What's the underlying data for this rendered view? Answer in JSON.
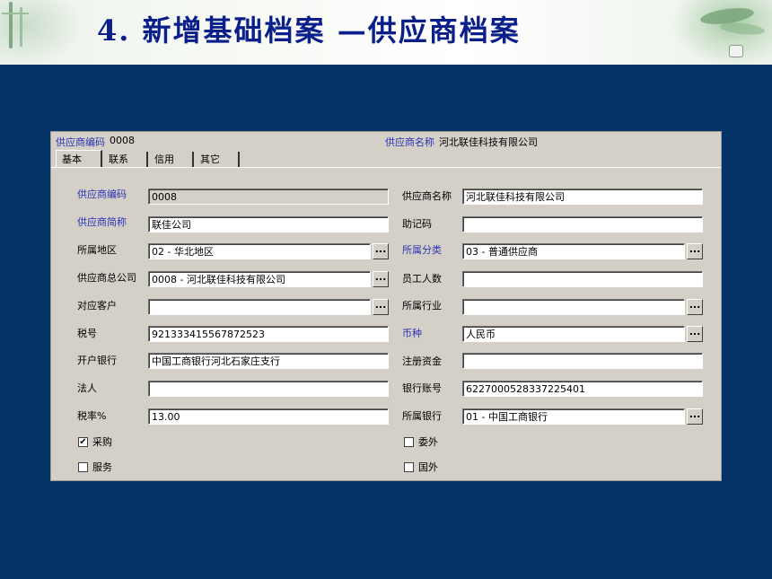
{
  "slide": {
    "title": "4. 新增基础档案 —供应商档案"
  },
  "header": {
    "code_label": "供应商编码",
    "code_value": "0008",
    "name_label": "供应商名称",
    "name_value": "河北联佳科技有限公司"
  },
  "tabs": [
    "基本",
    "联系",
    "信用",
    "其它"
  ],
  "active_tab": "基本",
  "form": {
    "supplier_code": {
      "label": "供应商编码",
      "value": "0008"
    },
    "supplier_name": {
      "label": "供应商名称",
      "value": "河北联佳科技有限公司"
    },
    "short_name": {
      "label": "供应商简称",
      "value": "联佳公司"
    },
    "mnemonic": {
      "label": "助记码",
      "value": ""
    },
    "region": {
      "label": "所属地区",
      "value": "02 - 华北地区"
    },
    "category": {
      "label": "所属分类",
      "value": "03 - 普通供应商"
    },
    "parent_company": {
      "label": "供应商总公司",
      "value": "0008 - 河北联佳科技有限公司"
    },
    "employees": {
      "label": "员工人数",
      "value": ""
    },
    "customer": {
      "label": "对应客户",
      "value": ""
    },
    "industry": {
      "label": "所属行业",
      "value": ""
    },
    "tax_id": {
      "label": "税号",
      "value": "921333415567872523"
    },
    "currency": {
      "label": "币种",
      "value": "人民币"
    },
    "bank": {
      "label": "开户银行",
      "value": "中国工商银行河北石家庄支行"
    },
    "capital": {
      "label": "注册资金",
      "value": ""
    },
    "legal_person": {
      "label": "法人",
      "value": ""
    },
    "account": {
      "label": "银行账号",
      "value": "6227000528337225401"
    },
    "tax_rate": {
      "label": "税率%",
      "value": "13.00"
    },
    "owning_bank": {
      "label": "所属银行",
      "value": "01 - 中国工商银行"
    }
  },
  "checkboxes": {
    "purchase": {
      "label": "采购",
      "checked": true,
      "mark": "✔"
    },
    "service": {
      "label": "服务",
      "checked": false,
      "mark": ""
    },
    "outsource": {
      "label": "委外",
      "checked": false,
      "mark": ""
    },
    "foreign": {
      "label": "国外",
      "checked": false,
      "mark": ""
    }
  },
  "buttons": {
    "browse_label": "..."
  },
  "colors": {
    "background": "#033465",
    "dialog": "#d4d0c8",
    "required_label": "#2b33b5",
    "title": "#0b1f8a"
  }
}
